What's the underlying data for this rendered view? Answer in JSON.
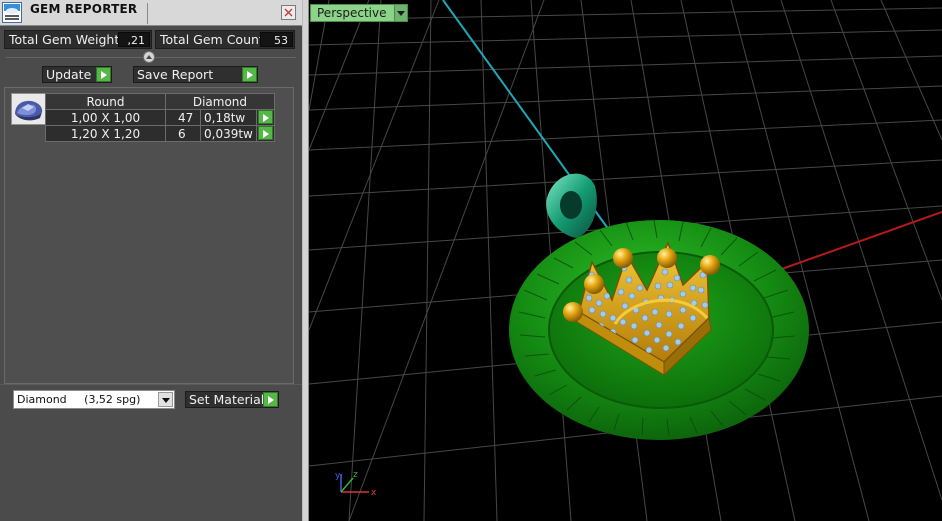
{
  "panel": {
    "title": "GEM REPORTER",
    "icons": {
      "app": "gem-reporter-app-icon",
      "close": "close-icon",
      "collapse": "collapse-up-icon",
      "play": "play-arrow-icon"
    },
    "stats": {
      "weight_label": "Total Gem Weight",
      "weight_value": ",21",
      "count_label": "Total Gem Count",
      "count_value": "53"
    },
    "buttons": {
      "update": "Update",
      "save_report": "Save Report"
    },
    "table": {
      "headers": [
        "Round",
        "Diamond"
      ],
      "rows": [
        {
          "size": "1,00 X 1,00",
          "count": "47",
          "weight": "0,18tw"
        },
        {
          "size": "1,20 X 1,20",
          "count": "6",
          "weight": "0,039tw"
        }
      ]
    },
    "material": {
      "selected": "Diamond     (3,52 spg)",
      "set_label": "Set Material"
    }
  },
  "viewport": {
    "view_name": "Perspective",
    "axes": {
      "x": "x",
      "y": "y",
      "z": "z"
    }
  },
  "colors": {
    "accent_green": "#56b64a",
    "view_label_green": "#8bd489",
    "model_green": "#1e9e1a",
    "gold": "#e2a810",
    "diamond_blue": "#a6c9e8",
    "bail_teal": "#1ea17a",
    "grid_line": "#4a4a4a",
    "axis_cyan": "#1fa8b8",
    "axis_red": "#b51a1a"
  }
}
